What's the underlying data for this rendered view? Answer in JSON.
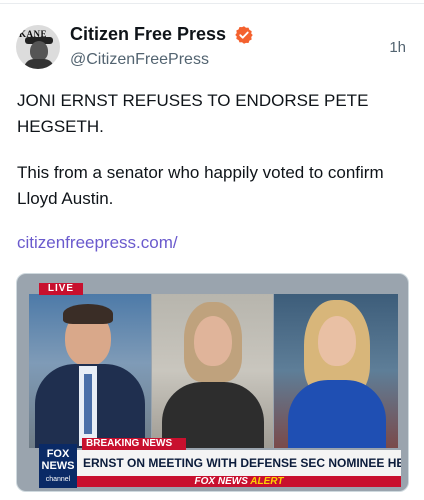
{
  "tweet": {
    "display_name": "Citizen Free Press",
    "handle": "@CitizenFreePress",
    "time": "1h",
    "avatar_text": "KANE",
    "text_line1": "JONI ERNST REFUSES TO ENDORSE PETE HEGSETH.",
    "text_line2": "This from a senator who happily voted to confirm Lloyd Austin.",
    "link": "citizenfreepress.com/"
  },
  "media": {
    "live": "LIVE",
    "breaking": "BREAKING NEWS",
    "headline": "ERNST ON MEETING WITH DEFENSE SEC NOMINEE HEGSETH",
    "alert_prefix": "FOX NEWS",
    "alert_suffix": "ALERT",
    "logo_line1": "FOX",
    "logo_line2": "NEWS",
    "logo_line3": "channel"
  },
  "colors": {
    "verified": "#f4612e",
    "link": "#6a5acd",
    "fox_red": "#c8102e",
    "fox_blue": "#0a2a66"
  },
  "icons": {
    "verified": "verified-badge-icon"
  }
}
